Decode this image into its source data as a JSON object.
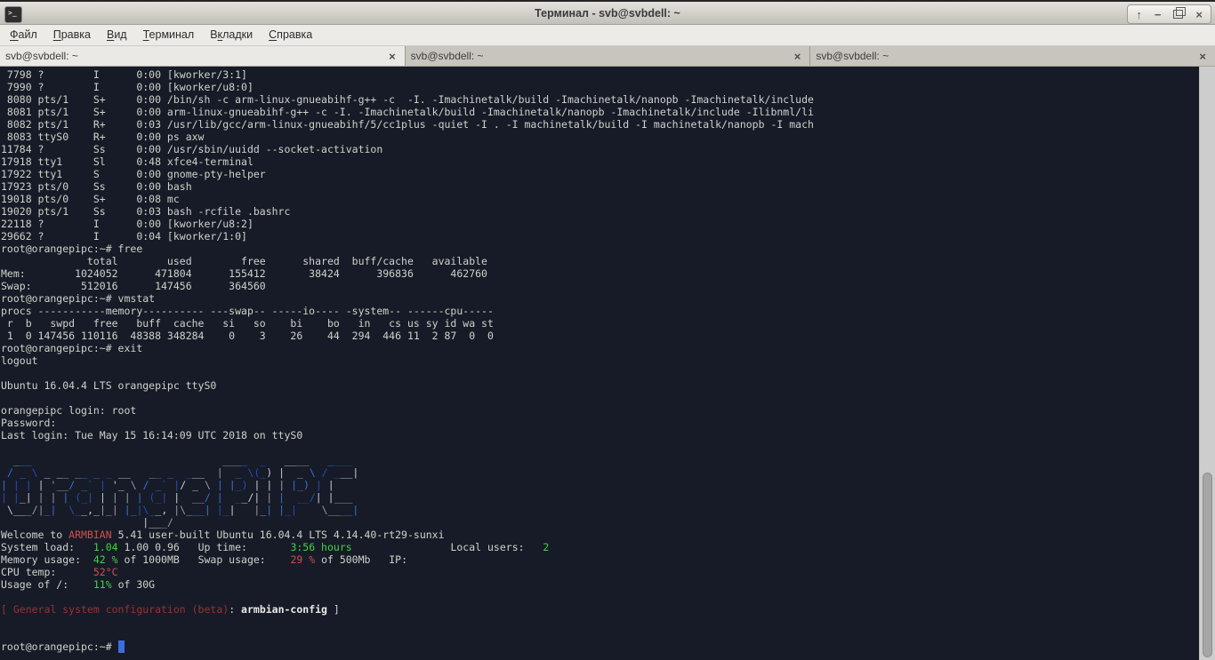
{
  "window": {
    "title": "Терминал - svb@svbdell: ~",
    "menu": [
      {
        "id": "file",
        "label": "Файл",
        "accel": 0
      },
      {
        "id": "edit",
        "label": "Правка",
        "accel": 0
      },
      {
        "id": "view",
        "label": "Вид",
        "accel": 0
      },
      {
        "id": "terminal",
        "label": "Терминал",
        "accel": 0
      },
      {
        "id": "tabs",
        "label": "Вкладки",
        "accel": 1
      },
      {
        "id": "help",
        "label": "Справка",
        "accel": 0
      }
    ],
    "tabs": [
      {
        "label": "svb@svbdell: ~",
        "active": true
      },
      {
        "label": "svb@svbdell: ~",
        "active": false
      },
      {
        "label": "svb@svbdell: ~",
        "active": false
      }
    ],
    "tab_close_glyph": "×",
    "controls": [
      {
        "name": "shade-button",
        "glyph": "↑"
      },
      {
        "name": "minimize-button",
        "glyph": "−"
      },
      {
        "name": "maximize-button",
        "shape": "restore"
      },
      {
        "name": "close-button",
        "glyph": "×"
      }
    ],
    "app_icon_glyph": ">_"
  },
  "colors": {
    "terminal_bg": "#161b27",
    "terminal_fg": "#cfd3cb",
    "green": "#43d543",
    "red": "#d14f4f",
    "dark_red": "#963431",
    "cursor_blue": "#3c6eda"
  },
  "terminal": {
    "art_palette": [
      "#969ca4",
      "#3a6fd8",
      "#2450b4",
      "#c6cbd2"
    ],
    "lines": [
      " 7798 ?        I      0:00 [kworker/3:1]",
      " 7990 ?        I      0:00 [kworker/u8:0]",
      " 8080 pts/1    S+     0:00 /bin/sh -c arm-linux-gnueabihf-g++ -c  -I. -Imachinetalk/build -Imachinetalk/nanopb -Imachinetalk/include",
      " 8081 pts/1    S+     0:00 arm-linux-gnueabihf-g++ -c -I. -Imachinetalk/build -Imachinetalk/nanopb -Imachinetalk/include -Ilibnml/li",
      " 8082 pts/1    R+     0:03 /usr/lib/gcc/arm-linux-gnueabihf/5/cc1plus -quiet -I . -I machinetalk/build -I machinetalk/nanopb -I mach",
      " 8083 ttyS0    R+     0:00 ps axw",
      "11784 ?        Ss     0:00 /usr/sbin/uuidd --socket-activation",
      "17918 tty1     Sl     0:48 xfce4-terminal",
      "17922 tty1     S      0:00 gnome-pty-helper",
      "17923 pts/0    Ss     0:00 bash",
      "19018 pts/0    S+     0:08 mc",
      "19020 pts/1    Ss     0:03 bash -rcfile .bashrc",
      "22118 ?        I      0:00 [kworker/u8:2]",
      "29662 ?        I      0:04 [kworker/1:0]",
      "root@orangepipc:~# free",
      "              total        used        free      shared  buff/cache   available",
      "Mem:        1024052      471804      155412       38424      396836      462760",
      "Swap:        512016      147456      364560",
      "root@orangepipc:~# vmstat",
      "procs -----------memory---------- ---swap-- -----io---- -system-- ------cpu-----",
      " r  b   swpd   free   buff  cache   si   so    bi    bo   in   cs us sy id wa st",
      " 1  0 147456 110116  48388 348284    0    3    26    44  294  446 11  2 87  0  0",
      "root@orangepipc:~# exit",
      "logout",
      "",
      "Ubuntu 16.04.4 LTS orangepipc ttyS0",
      "",
      "orangepipc login: root",
      "Password:",
      "Last login: Tue May 15 16:14:09 UTC 2018 on ttyS0",
      "",
      {
        "art": "  ___                               ____  _   ____   ____ ",
        "row": 0
      },
      {
        "art": " / _ \\ _ __ __ _ _ __   __ _  ___  |  _ \\(_) |  _ \\ / ___|",
        "row": 1
      },
      {
        "art": "| | | | '__/ _` | '_ \\ / _` |/ _ \\ | |_) | | | |_) | |    ",
        "row": 2
      },
      {
        "art": "| |_| | | | (_| | | | | (_| |  __/ |  __/| | |  __/| |___ ",
        "row": 3
      },
      {
        "art": " \\___/|_|  \\__,_|_| |_|\\__, |\\___| |_|   |_| |_|    \\____|",
        "row": 4
      },
      {
        "art": "                       |___/                               ",
        "row": 5
      },
      {
        "segs": [
          {
            "t": "Welcome to "
          },
          {
            "t": "ARMBIAN",
            "c": "red"
          },
          {
            "t": " 5.41 user-built Ubuntu 16.04.4 LTS 4.14.40-rt29-sunxi"
          }
        ]
      },
      {
        "segs": [
          {
            "t": "System load:   "
          },
          {
            "t": "1.04",
            "c": "green"
          },
          {
            "t": " 1.00 0.96   Up time:       "
          },
          {
            "t": "3:56 hours",
            "c": "green"
          },
          {
            "t": "                Local users:   "
          },
          {
            "t": "2",
            "c": "green"
          }
        ]
      },
      {
        "segs": [
          {
            "t": "Memory usage:  "
          },
          {
            "t": "42 %",
            "c": "green"
          },
          {
            "t": " of 1000MB   Swap usage:    "
          },
          {
            "t": "29 %",
            "c": "red"
          },
          {
            "t": " of 500Mb   IP:"
          }
        ]
      },
      {
        "segs": [
          {
            "t": "CPU temp:      "
          },
          {
            "t": "52°C",
            "c": "red"
          }
        ]
      },
      {
        "segs": [
          {
            "t": "Usage of /:    "
          },
          {
            "t": "11%",
            "c": "green"
          },
          {
            "t": " of 30G"
          }
        ]
      },
      "",
      {
        "segs": [
          {
            "t": "[ General system configuration (beta)",
            "c": "darkred"
          },
          {
            "t": ": "
          },
          {
            "t": "armbian-config",
            "c": "boldw"
          },
          {
            "t": " ]"
          }
        ]
      },
      "",
      "",
      {
        "segs": [
          {
            "t": "root@orangepipc:~# "
          },
          {
            "t": " ",
            "c": "cursor"
          }
        ]
      }
    ]
  }
}
